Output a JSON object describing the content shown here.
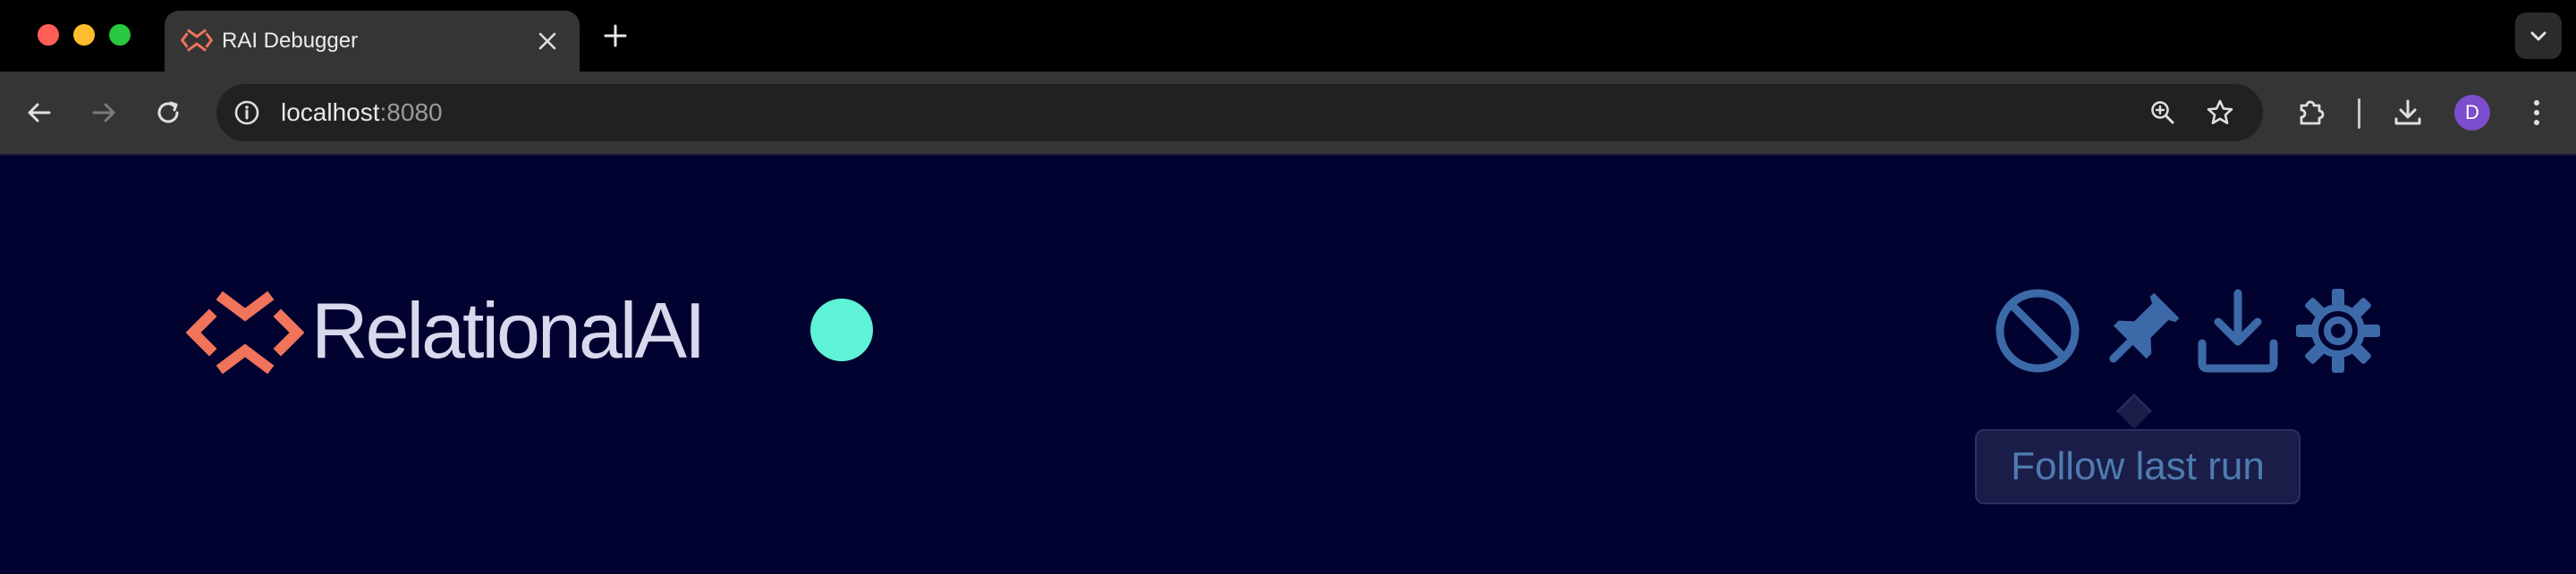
{
  "browser": {
    "tab": {
      "title": "RAI Debugger",
      "icon": "relationalai-logo-icon"
    },
    "address": {
      "host": "localhost",
      "port": ":8080"
    },
    "profile": {
      "initial": "D"
    }
  },
  "app": {
    "brand": {
      "name_bold": "Relational",
      "name_light": "AI"
    },
    "status": {
      "color": "#5ef2d6"
    },
    "actions": [
      {
        "name": "clear-icon"
      },
      {
        "name": "pin-icon"
      },
      {
        "name": "download-icon"
      },
      {
        "name": "settings-gear-icon"
      }
    ],
    "tooltip": {
      "text": "Follow last run"
    }
  },
  "colors": {
    "page_bg": "#020230",
    "accent_orange": "#f0745a",
    "icon_blue": "#3c6aa8",
    "status_teal": "#5ef2d6"
  }
}
